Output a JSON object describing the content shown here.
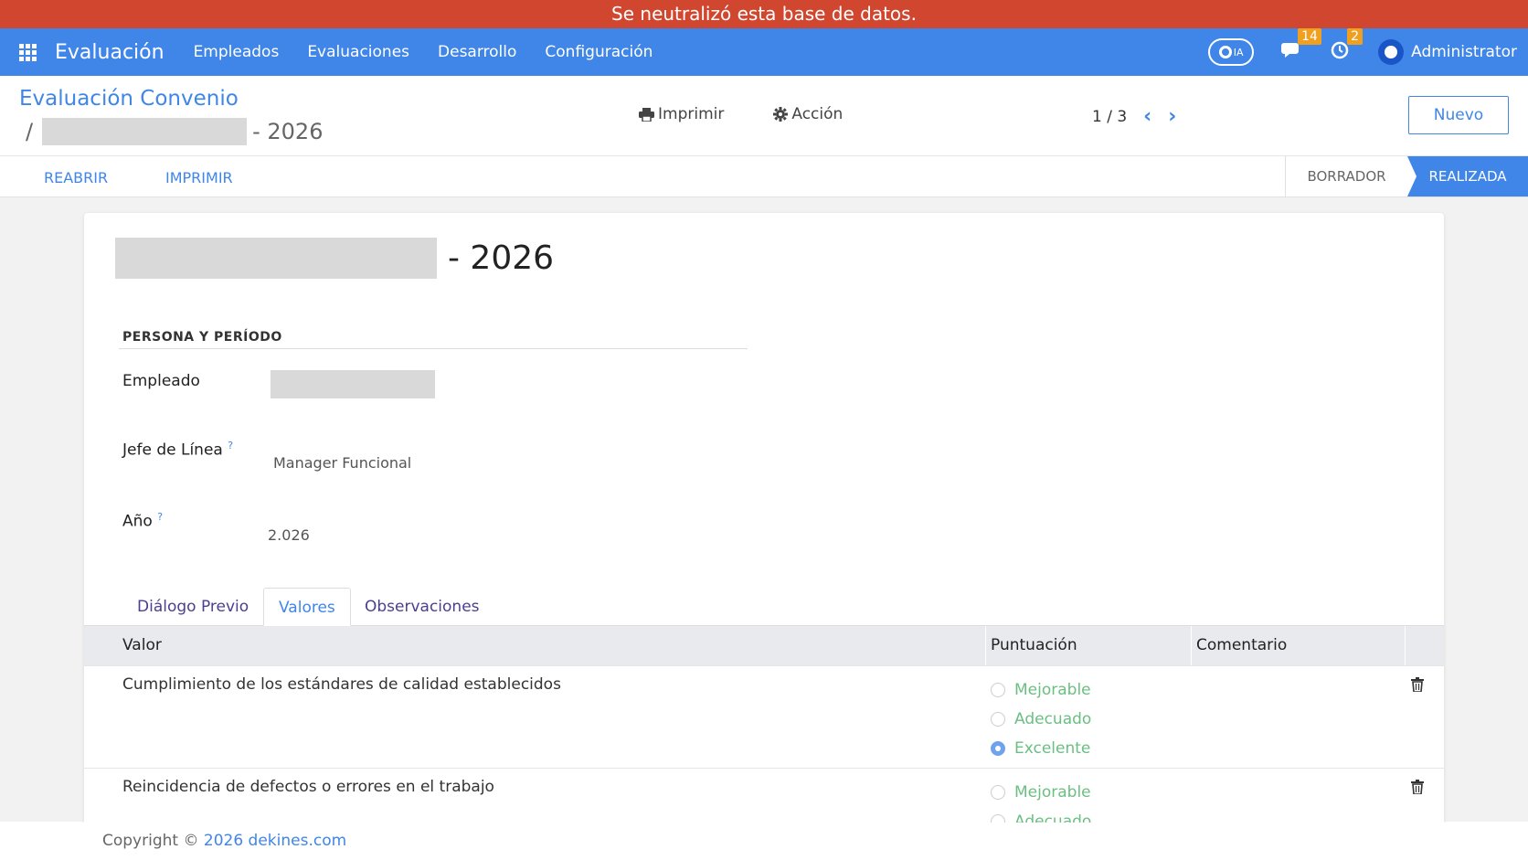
{
  "banner": {
    "text": "Se neutralizó esta base de datos."
  },
  "navbar": {
    "app_title": "Evaluación",
    "menu": [
      "Empleados",
      "Evaluaciones",
      "Desarrollo",
      "Configuración"
    ],
    "ia_label": "IA",
    "messages_count": "14",
    "activities_count": "2",
    "user_name": "Administrator"
  },
  "control_panel": {
    "breadcrumb_parent": "Evaluación Convenio",
    "breadcrumb_sep": "/",
    "breadcrumb_suffix": "- 2026",
    "print_label": "Imprimir",
    "action_label": "Acción",
    "pager": "1 / 3",
    "new_label": "Nuevo"
  },
  "statusbar": {
    "buttons": [
      "REABRIR",
      "IMPRIMIR"
    ],
    "stages": [
      "BORRADOR",
      "REALIZADA"
    ],
    "active_stage": "REALIZADA"
  },
  "record": {
    "title_suffix": "- 2026",
    "section_title": "PERSONA Y PERÍODO",
    "fields": {
      "employee_label": "Empleado",
      "manager_label": "Jefe de Línea",
      "manager_value": "Manager Funcional",
      "year_label": "Año",
      "year_value": "2.026",
      "help_mark": "?"
    }
  },
  "tabs": [
    "Diálogo Previo",
    "Valores",
    "Observaciones"
  ],
  "active_tab": "Valores",
  "table": {
    "headers": [
      "Valor",
      "Puntuación",
      "Comentario"
    ],
    "options": [
      "Mejorable",
      "Adecuado",
      "Excelente"
    ],
    "rows": [
      {
        "valor": "Cumplimiento de los estándares de calidad establecidos",
        "selected": "Excelente"
      },
      {
        "valor": "Reincidencia de defectos o errores en el trabajo",
        "selected": ""
      }
    ]
  },
  "footer": {
    "prefix": "Copyright © ",
    "link": "2026 dekines.com"
  },
  "colors": {
    "banner": "#d0462e",
    "navbar": "#3f86e8",
    "accent": "#3f86e8",
    "radio_label": "#6bbf82"
  }
}
